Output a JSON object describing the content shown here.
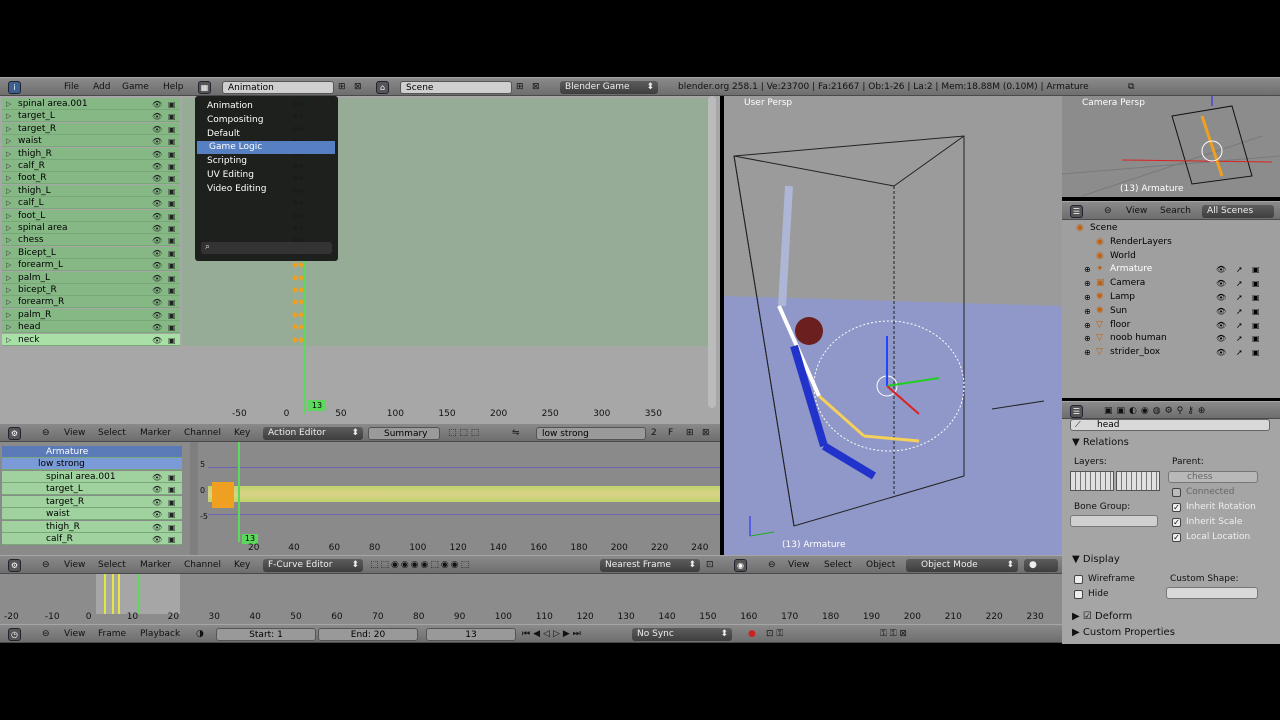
{
  "info": {
    "menus": [
      "File",
      "Add",
      "Game",
      "Help"
    ],
    "screen_layout": "Animation",
    "scene": "Scene",
    "engine": "Blender Game",
    "stats": "blender.org 258.1 | Ve:23700 | Fa:21667 | Ob:1-26 | La:2 | Mem:18.88M (0.10M) | Armature"
  },
  "layout_menu": {
    "items": [
      "Animation",
      "Compositing",
      "Default",
      "Game Logic",
      "Scripting",
      "UV Editing",
      "Video Editing"
    ],
    "highlighted": "Game Logic",
    "search_value": ""
  },
  "dopesheet": {
    "channels": [
      "spinal area.001",
      "target_L",
      "target_R",
      "waist",
      "thigh_R",
      "calf_R",
      "foot_R",
      "thigh_L",
      "calf_L",
      "foot_L",
      "spinal area",
      "chess",
      "Bicept_L",
      "forearm_L",
      "palm_L",
      "bicept_R",
      "forearm_R",
      "palm_R",
      "head",
      "neck"
    ],
    "ruler": [
      "-50",
      "0",
      "50",
      "100",
      "150",
      "200",
      "250",
      "300",
      "350"
    ],
    "current_frame": "13"
  },
  "action_header": {
    "menus": [
      "View",
      "Select",
      "Marker",
      "Channel",
      "Key"
    ],
    "mode": "Action Editor",
    "summary": "Summary",
    "action_name": "low strong",
    "users": "2",
    "fake": "F"
  },
  "action_editor": {
    "armature": "Armature",
    "action": "low strong",
    "channels": [
      "spinal area.001",
      "target_L",
      "target_R",
      "waist",
      "thigh_R",
      "calf_R"
    ],
    "ruler": [
      "20",
      "40",
      "60",
      "80",
      "100",
      "120",
      "140",
      "160",
      "180",
      "200",
      "220",
      "240"
    ],
    "current_frame": "13",
    "y_labels": [
      "5",
      "0",
      "-5"
    ]
  },
  "fcurve_header": {
    "menus": [
      "View",
      "Select",
      "Marker",
      "Channel",
      "Key"
    ],
    "mode": "F-Curve Editor",
    "snap": "Nearest Frame"
  },
  "timeline_ruler": [
    "-20",
    "-10",
    "0",
    "10",
    "20",
    "30",
    "40",
    "50",
    "60",
    "70",
    "80",
    "90",
    "100",
    "110",
    "120",
    "130",
    "140",
    "150",
    "160",
    "170",
    "180",
    "190",
    "200",
    "210",
    "220",
    "230"
  ],
  "timeline_header": {
    "menus": [
      "View",
      "Frame",
      "Playback"
    ],
    "start": "Start: 1",
    "end": "End: 20",
    "frame": "13",
    "sync": "No Sync"
  },
  "viewport": {
    "label": "User Persp",
    "object_label": "(13) Armature",
    "menus": [
      "View",
      "Select",
      "Object"
    ],
    "mode": "Object Mode"
  },
  "camera_view": {
    "label": "Camera Persp",
    "object_label": "(13) Armature"
  },
  "outliner": {
    "menus": [
      "View",
      "Search"
    ],
    "filter": "All Scenes",
    "items": [
      {
        "name": "Scene",
        "icon": "scene-icon"
      },
      {
        "name": "RenderLayers",
        "icon": "renderlayers-icon"
      },
      {
        "name": "World",
        "icon": "world-icon"
      },
      {
        "name": "Armature",
        "icon": "armature-icon"
      },
      {
        "name": "Camera",
        "icon": "camera-icon"
      },
      {
        "name": "Lamp",
        "icon": "lamp-icon"
      },
      {
        "name": "Sun",
        "icon": "sun-icon"
      },
      {
        "name": "floor",
        "icon": "mesh-icon"
      },
      {
        "name": "noob human",
        "icon": "mesh-icon"
      },
      {
        "name": "strider_box",
        "icon": "mesh-icon"
      }
    ]
  },
  "properties": {
    "bone_name": "head",
    "relations": "Relations",
    "layers_label": "Layers:",
    "parent_label": "Parent:",
    "parent_value": "chess",
    "connected": "Connected",
    "bone_group_label": "Bone Group:",
    "inherit_rotation": "Inherit Rotation",
    "inherit_scale": "Inherit Scale",
    "local_location": "Local Location",
    "display": "Display",
    "wireframe": "Wireframe",
    "hide": "Hide",
    "custom_shape": "Custom Shape:",
    "deform": "Deform",
    "custom_properties": "Custom Properties"
  },
  "colors": {
    "accent": "#5680c2",
    "channel_green": "#86b886",
    "viewport_floor": "#8f98c8",
    "keyframe": "#f0a020"
  }
}
